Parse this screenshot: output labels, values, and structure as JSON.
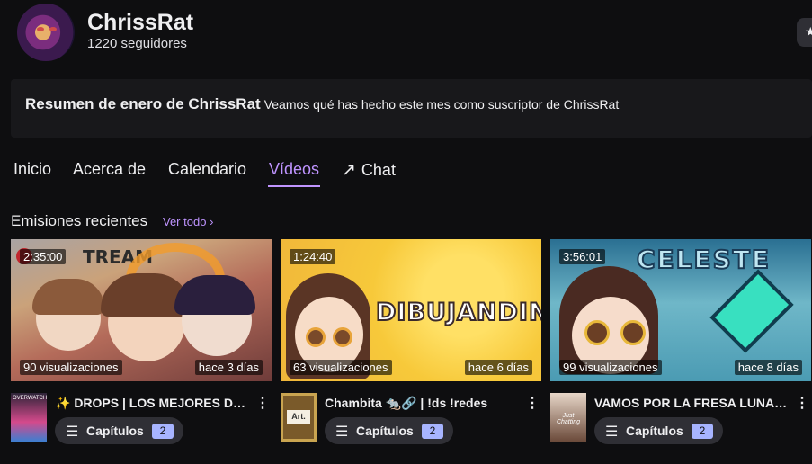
{
  "channel": {
    "name": "ChrissRat",
    "followers": "1220 seguidores"
  },
  "recap": {
    "title": "Resumen de enero de ChrissRat",
    "subtitle": "Veamos qué has hecho este mes como suscriptor de ChrissRat"
  },
  "tabs": [
    {
      "label": "Inicio"
    },
    {
      "label": "Acerca de"
    },
    {
      "label": "Calendario"
    },
    {
      "label": "Vídeos",
      "active": true
    },
    {
      "label": "Chat",
      "icon": "external-arrow-icon"
    }
  ],
  "section": {
    "title": "Emisiones recientes",
    "see_all": "Ver todo"
  },
  "videos": [
    {
      "duration": "2:35:00",
      "views": "90 visualizaciones",
      "ago": "hace 3 días",
      "thumb_text": "TREAM",
      "title": "✨ DROPS | LOS MEJORES DE OVERWATCH",
      "category_label": "OVERWATCH",
      "chapters_label": "Capítulos",
      "chapters_count": "2"
    },
    {
      "duration": "1:24:40",
      "views": "63 visualizaciones",
      "ago": "hace 6 días",
      "thumb_text": "DIBUJANDING",
      "title": "Chambita 🐀🔗 | !ds !redes",
      "category_label": "Art.",
      "chapters_label": "Capítulos",
      "chapters_count": "2"
    },
    {
      "duration": "3:56:01",
      "views": "99 visualizaciones",
      "ago": "hace 8 días",
      "thumb_text": "CELESTE",
      "title": "VAMOS POR LA FRESA LUNAAR",
      "category_label": "Just Chatting",
      "chapters_label": "Capítulos",
      "chapters_count": "2"
    }
  ],
  "colors": {
    "accent": "#bf94ff",
    "background": "#0e0e10",
    "panel": "#18181b",
    "chip": "#2f2f35",
    "count_badge": "#a7b4ff"
  }
}
